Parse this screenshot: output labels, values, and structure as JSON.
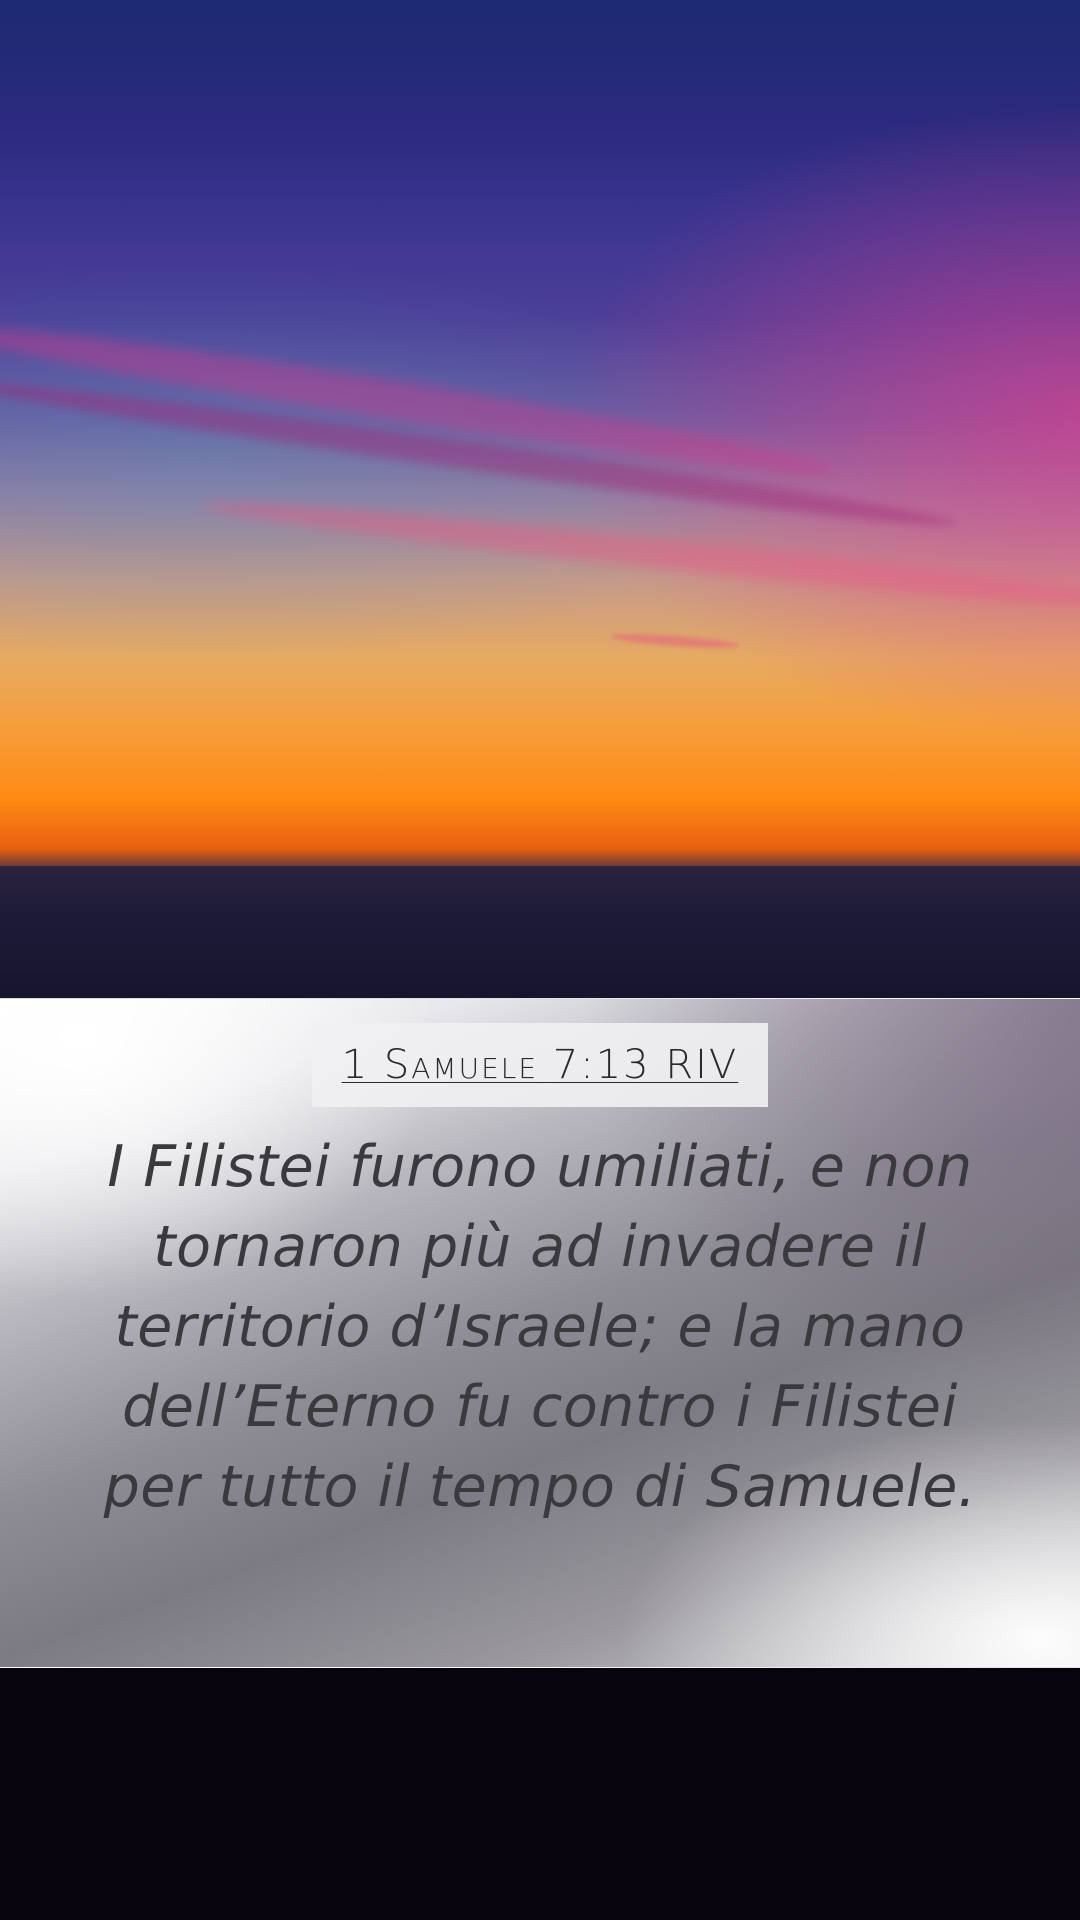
{
  "reference": {
    "text": "1 Samuele 7:13 RIV"
  },
  "verse": {
    "text": "I Filistei furono umiliati, e non tornaron più ad invadere il territorio d’Israele; e la mano dell’Eterno fu contro i Filistei per tutto il tempo di Samuele."
  },
  "colors": {
    "sky_top": "#1d2a72",
    "sky_pink": "#e63c8c",
    "sky_orange": "#ff8a14",
    "panel_light": "#ffffff",
    "panel_grey": "#7c7a82",
    "text": "#3a3a3e",
    "background": "#07040d"
  }
}
